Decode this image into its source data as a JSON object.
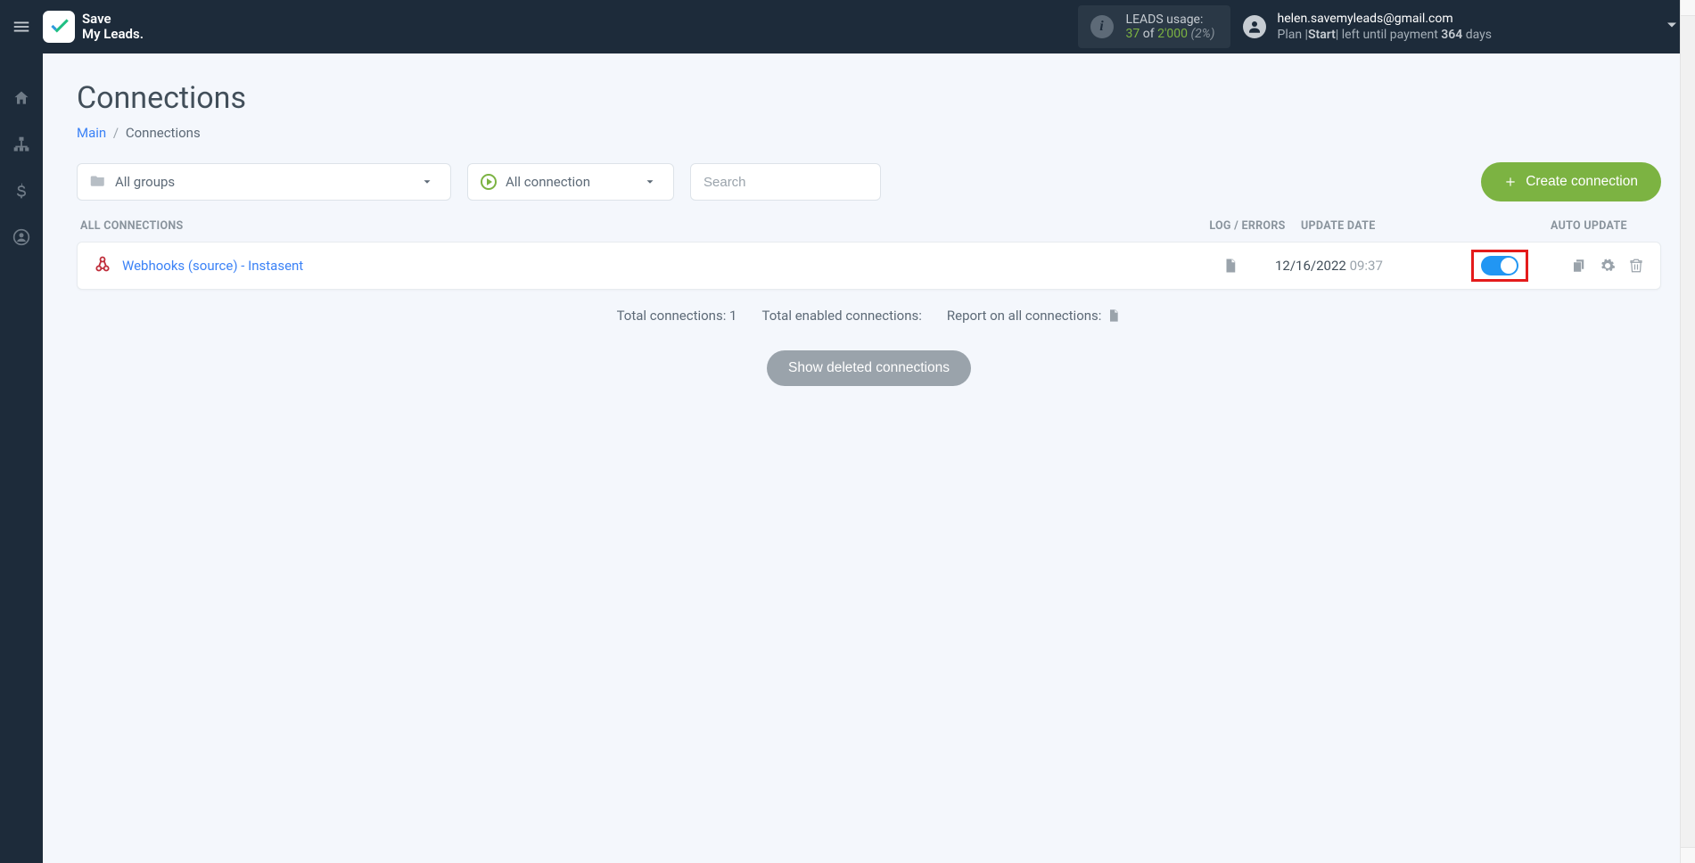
{
  "app": {
    "name_line1": "Save",
    "name_line2": "My Leads."
  },
  "usage": {
    "label": "LEADS usage:",
    "used": "37",
    "of_word": "of",
    "max": "2'000",
    "pct": "(2%)"
  },
  "account": {
    "email": "helen.savemyleads@gmail.com",
    "plan_prefix": "Plan |",
    "plan_name": "Start",
    "plan_suffix": "| left until payment ",
    "days_value": "364",
    "days_word": " days"
  },
  "page": {
    "title": "Connections",
    "breadcrumb_main": "Main",
    "breadcrumb_current": "Connections"
  },
  "filters": {
    "groups_label": "All groups",
    "connection_label": "All connection",
    "search_placeholder": "Search",
    "create_button": "Create connection"
  },
  "columns": {
    "name": "ALL CONNECTIONS",
    "log": "LOG / ERRORS",
    "date": "UPDATE DATE",
    "auto": "AUTO UPDATE"
  },
  "rows": [
    {
      "name": "Webhooks (source) - Instasent",
      "date": "12/16/2022",
      "time": "09:37",
      "auto_on": true
    }
  ],
  "footer": {
    "total": "Total connections: 1",
    "enabled": "Total enabled connections:",
    "report": "Report on all connections:",
    "show_deleted": "Show deleted connections"
  }
}
